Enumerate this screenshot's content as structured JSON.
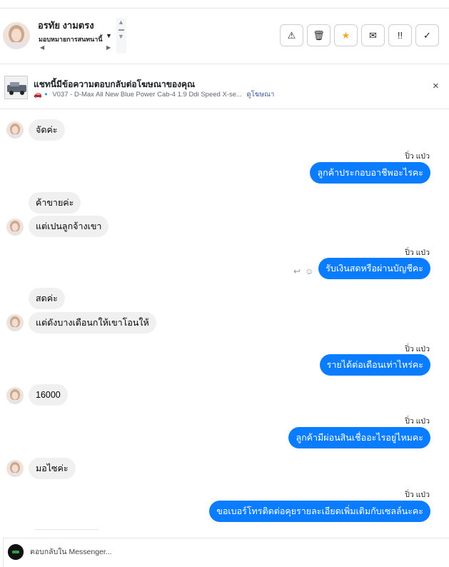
{
  "header": {
    "contact_name": "อรทัย งามตรง",
    "assign_label": "มอบหมายการสนทนานี้",
    "actions": [
      {
        "icon": "warning-icon",
        "glyph": "⚠"
      },
      {
        "icon": "trash-icon",
        "glyph": "🗑"
      },
      {
        "icon": "star-icon",
        "glyph": "★"
      },
      {
        "icon": "envelope-icon",
        "glyph": "✉"
      },
      {
        "icon": "mark-unread-icon",
        "glyph": "!!"
      },
      {
        "icon": "check-icon",
        "glyph": "✓"
      }
    ]
  },
  "ad": {
    "title": "แชทนี้มีข้อความตอบกลับต่อโฆษณาของคุณ",
    "subtitle": "V037 - D-Max All New Blue Power Cab-4 1.9 Ddi Speed X-se...",
    "link": "ดูโฆษณา",
    "close_glyph": "×"
  },
  "messages": [
    {
      "from": "customer",
      "text": "จัดค่ะ"
    },
    {
      "from": "page",
      "sender": "ปิ่ว แป่ว",
      "text": "ลูกค้าประกอบอาชีพอะไรคะ"
    },
    {
      "from": "customer",
      "text": "ค้าขายค่ะ"
    },
    {
      "from": "customer",
      "text": "แต่เปนลูกจ้างเขา"
    },
    {
      "from": "page",
      "sender": "ปิ่ว แป่ว",
      "text": "รับเงินสดหรือผ่านบัญชีคะ"
    },
    {
      "from": "customer",
      "text": "สดค่ะ"
    },
    {
      "from": "customer",
      "text": "แต่ดังบางเดือนกให้เขาโอนให้"
    },
    {
      "from": "page",
      "sender": "ปิ่ว แป่ว",
      "text": "รายได้ต่อเดือนเท่าไหร่คะ"
    },
    {
      "from": "customer",
      "text": "16000"
    },
    {
      "from": "page",
      "sender": "ปิ่ว แป่ว",
      "text": "ลูกค้ามีผ่อนสินเชื่ออะไรอยู่ไหมคะ"
    },
    {
      "from": "customer",
      "text": "มอไซค่ะ"
    },
    {
      "from": "page",
      "sender": "ปิ่ว แป่ว",
      "text": "ขอเบอร์โทรติดต่อคุยรายละเอียดเพิ่มเติมกับเซลล์นะคะ"
    }
  ],
  "reply": {
    "placeholder": "ตอบกลับใน Messenger..."
  },
  "colors": {
    "outgoing_bubble": "#0a7cff",
    "incoming_bubble": "#f0f0f0",
    "link": "#385898",
    "star": "#f5a623"
  }
}
